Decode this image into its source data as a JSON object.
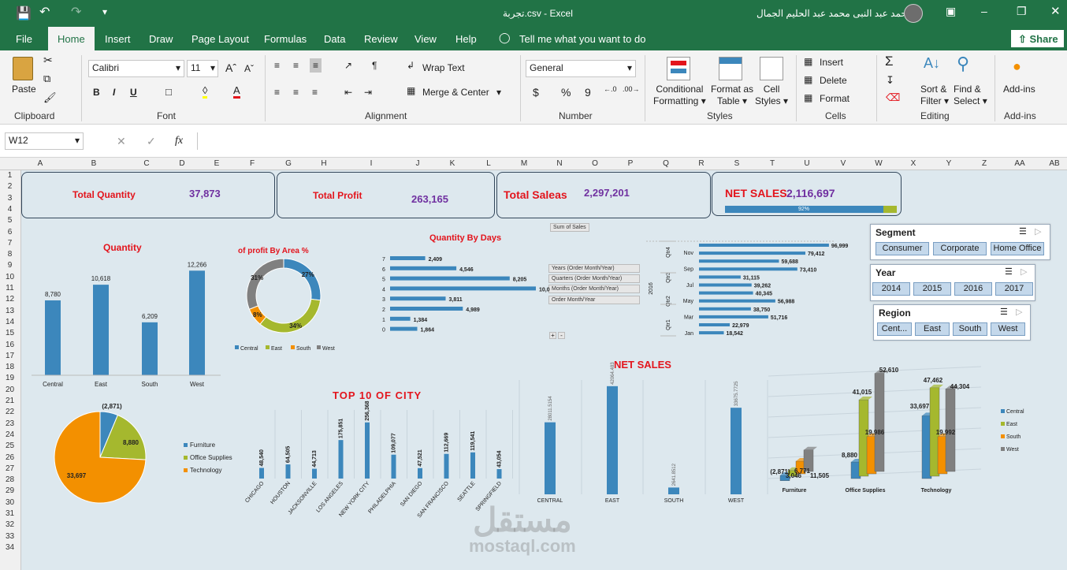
{
  "window": {
    "filename": "تجربة.csv",
    "app": "Excel",
    "separator": "-",
    "user": "احمد عبد النبى محمد عبد الحليم الجمال"
  },
  "tabs": [
    "File",
    "Home",
    "Insert",
    "Draw",
    "Page Layout",
    "Formulas",
    "Data",
    "Review",
    "View",
    "Help"
  ],
  "tell_me": "Tell me what you want to do",
  "share": "Share",
  "ribbon": {
    "paste": "Paste",
    "clipboard": "Clipboard",
    "font_name": "Calibri",
    "font_size": "11",
    "font": "Font",
    "wrap": "Wrap Text",
    "merge": "Merge & Center",
    "alignment": "Alignment",
    "number_format": "General",
    "number": "Number",
    "cond1": "Conditional",
    "cond2": "Formatting",
    "fmt_table1": "Format as",
    "fmt_table2": "Table",
    "cell_styles1": "Cell",
    "cell_styles2": "Styles",
    "styles": "Styles",
    "insert": "Insert",
    "delete": "Delete",
    "format": "Format",
    "cells": "Cells",
    "sort1": "Sort &",
    "sort2": "Filter",
    "find1": "Find &",
    "find2": "Select",
    "editing": "Editing",
    "addins": "Add-ins",
    "addins_grp": "Add-ins"
  },
  "formula_bar": {
    "name_box": "W12",
    "fx": "fx",
    "value": ""
  },
  "columns": [
    "A",
    "B",
    "C",
    "D",
    "E",
    "F",
    "G",
    "H",
    "I",
    "J",
    "K",
    "L",
    "M",
    "N",
    "O",
    "P",
    "Q",
    "R",
    "S",
    "T",
    "U",
    "V",
    "W",
    "X",
    "Y",
    "Z",
    "AA",
    "AB"
  ],
  "rows": [
    "1",
    "2",
    "3",
    "4",
    "5",
    "6",
    "7",
    "8",
    "9",
    "10",
    "11",
    "12",
    "13",
    "14",
    "15",
    "16",
    "17",
    "18",
    "19",
    "20",
    "21",
    "22",
    "23",
    "24",
    "25",
    "26",
    "27",
    "28",
    "29",
    "30",
    "31",
    "32",
    "33",
    "34"
  ],
  "kpis": {
    "total_quantity": {
      "label": "Total Quantity",
      "value": "37,873"
    },
    "total_profit": {
      "label": "Total Profit",
      "value": "263,165"
    },
    "total_sales": {
      "label": "Total Saleas",
      "value": "2,297,201"
    },
    "net_sales": {
      "label": "NET SALES",
      "value": "2,116,697",
      "progress": 0.92,
      "progress_label": "92%"
    }
  },
  "pivot": {
    "sum_of_sales": "Sum of Sales",
    "fields": [
      "Years (Order Month/Year)",
      "Quarters (Order Month/Year)",
      "Months (Order Month/Year)",
      "Order Month/Year"
    ]
  },
  "slicers": {
    "segment": {
      "title": "Segment",
      "items": [
        "Consumer",
        "Corporate",
        "Home Office"
      ]
    },
    "year": {
      "title": "Year",
      "items": [
        "2014",
        "2015",
        "2016",
        "2017"
      ]
    },
    "region": {
      "title": "Region",
      "items": [
        "Cent...",
        "East",
        "South",
        "West"
      ]
    }
  },
  "chart_data": [
    {
      "id": "quantity",
      "type": "bar",
      "title": "Quantity",
      "categories": [
        "Central",
        "East",
        "South",
        "West"
      ],
      "values": [
        8780,
        10618,
        6209,
        12266
      ],
      "labels": [
        "8,780",
        "10,618",
        "6,209",
        "12,266"
      ],
      "color": "#3c87bc"
    },
    {
      "id": "profit_area",
      "type": "pie",
      "title": "of profit By Area %",
      "categories": [
        "Central",
        "East",
        "South",
        "West"
      ],
      "values": [
        27,
        34,
        8,
        31
      ],
      "labels": [
        "27%",
        "34%",
        "8%",
        "31%"
      ],
      "colors": [
        "#3c87bc",
        "#a5b82e",
        "#f39000",
        "#808080"
      ]
    },
    {
      "id": "quantity_days",
      "type": "bar",
      "title": "Quantity By Days",
      "categories": [
        "7",
        "6",
        "5",
        "4",
        "3",
        "2",
        "1",
        "0"
      ],
      "values": [
        2409,
        4546,
        8205,
        10000,
        3811,
        4989,
        1384,
        1864
      ],
      "labels": [
        "2,409",
        "4,546",
        "8,205",
        "10,0",
        "3,811",
        "4,989",
        "1,384",
        "1,864"
      ],
      "color": "#3c87bc"
    },
    {
      "id": "months_2016",
      "type": "bar",
      "year": "2016",
      "quarters": [
        "Qtr4",
        "Qtr3",
        "Qtr2",
        "Qtr1"
      ],
      "named_months": [
        "Nov",
        "Sep",
        "Jul",
        "May",
        "Mar",
        "Jan"
      ],
      "values": [
        96999,
        79412,
        59688,
        73410,
        31115,
        39262,
        40345,
        56988,
        38750,
        51716,
        22979,
        18542
      ],
      "labels": [
        "96,999",
        "79,412",
        "59,688",
        "73,410",
        "31,115",
        "39,262",
        "40,345",
        "56,988",
        "38,750",
        "51,716",
        "22,979",
        "18,542"
      ],
      "color": "#3c87bc"
    },
    {
      "id": "category_pie",
      "type": "pie",
      "categories": [
        "Furniture",
        "Office Supplies",
        "Technology"
      ],
      "values": [
        2871,
        8880,
        33697
      ],
      "labels": [
        "(2,871)",
        "8,880",
        "33,697"
      ],
      "colors": [
        "#3c87bc",
        "#a5b82e",
        "#f39000"
      ]
    },
    {
      "id": "top_city",
      "type": "bar",
      "title": "TOP 10 OF CITY",
      "categories": [
        "CHICAGO",
        "HOUSTON",
        "JACKSONVILLE",
        "LOS ANGELES",
        "NEW YORK CITY",
        "PHILADELPHIA",
        "SAN DIEGO",
        "SAN FRANCISCO",
        "SEATTLE",
        "SPRINGFIELD"
      ],
      "values": [
        48540,
        64505,
        44713,
        175851,
        256368,
        109077,
        47521,
        112669,
        119541,
        43054
      ],
      "labels": [
        "48,540",
        "64,505",
        "44,713",
        "175,851",
        "256,368",
        "109,077",
        "47,521",
        "112,669",
        "119,541",
        "43,054"
      ],
      "color": "#3c87bc"
    },
    {
      "id": "net_sales_region",
      "type": "bar",
      "title": "NET SALES",
      "categories": [
        "CENTRAL",
        "EAST",
        "SOUTH",
        "WEST"
      ],
      "values": [
        280115154,
        420644483,
        26418512,
        336757725
      ],
      "labels": [
        "28011.5154",
        "42064.483",
        "2641.8512",
        "33675.7725"
      ],
      "color": "#3c87bc"
    },
    {
      "id": "cat_region_3d",
      "type": "bar",
      "categories": [
        "Furniture",
        "Office Supplies",
        "Technology"
      ],
      "series": [
        {
          "name": "Central",
          "values": [
            -2871,
            8880,
            33697
          ],
          "color": "#3c87bc"
        },
        {
          "name": "East",
          "values": [
            3046,
            41015,
            47462
          ],
          "color": "#a5b82e"
        },
        {
          "name": "South",
          "values": [
            6771,
            19986,
            19992
          ],
          "color": "#f39000"
        },
        {
          "name": "West",
          "values": [
            11505,
            52610,
            44304
          ],
          "color": "#808080"
        }
      ],
      "labels": [
        [
          "(2,871)",
          "3,046",
          "6,771",
          "11,505"
        ],
        [
          "8,880",
          "41,015",
          "19,986",
          "52,610"
        ],
        [
          "33,697",
          "47,462",
          "19,992",
          "44,304"
        ]
      ]
    }
  ],
  "watermark": {
    "ar": "مستقل",
    "en": "mostaql.com"
  },
  "colors": {
    "excel_green": "#217346",
    "accent_red": "#e3141c",
    "value_purple": "#7030a0",
    "bar_blue": "#3c87bc"
  }
}
